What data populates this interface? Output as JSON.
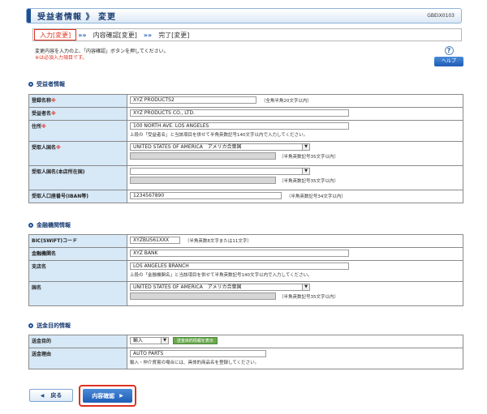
{
  "header": {
    "title": "受益者情報 》 変更",
    "screen_id": "GBEIX0103"
  },
  "steps": [
    {
      "label": "入力[変更]"
    },
    {
      "label": "内容確認[変更]"
    },
    {
      "label": "完了[変更]"
    }
  ],
  "step_separator": "»»",
  "instructions": {
    "line1": "変更内容を入力の上、「内容確認」ボタンを押してください。",
    "line2": "※は必須入力項目です。"
  },
  "help": {
    "icon": "?",
    "label": "ヘルプ"
  },
  "beneficiary": {
    "section_title": "受益者情報",
    "reg_name": {
      "label": "登録名称",
      "req": "※",
      "value": "XYZ PRODUCTS2",
      "note": "（全角半角20文字以内）"
    },
    "ben_name": {
      "label": "受益者名",
      "req": "※",
      "value": "XYZ PRODUCTS CO., LTD."
    },
    "address": {
      "label": "住所",
      "req": "※",
      "value": "100 NORTH AVE. LOS ANGELES",
      "note": "上段の「受益者名」と当該項目を併せて半角英数記号140文字以内で入力してください。"
    },
    "country": {
      "label": "受取人国名",
      "req": "※",
      "value": "UNITED STATES OF AMERICA　アメリカ合衆国",
      "note": "（半角英数記号35文字以内）"
    },
    "branch_country": {
      "label": "受取人国名(本店所在国)",
      "value": "",
      "note": "（半角英数記号35文字以内）"
    },
    "account": {
      "label": "受取人口座番号(IBAN等)",
      "value": "1234567890",
      "note": "（半角英数記号34文字以内）"
    }
  },
  "bank": {
    "section_title": "金融機関情報",
    "bic": {
      "label": "BIC(SWIFT)コード",
      "value": "XYZBUS61XXX",
      "note": "（半角英数8文字または11文字）"
    },
    "bank_name": {
      "label": "金融機関名",
      "value": "XYZ BANK"
    },
    "branch_name": {
      "label": "支店名",
      "value": "LOS ANGELES BRANCH",
      "note": "上段の「金融機関名」と当該項目を併せて半角英数記号140文字以内で入力してください。"
    },
    "country": {
      "label": "国名",
      "value": "UNITED STATES OF AMERICA　アメリカ合衆国",
      "note": "（半角英数記号35文字以内）"
    }
  },
  "purpose": {
    "section_title": "送金目的情報",
    "purpose": {
      "label": "送金目的",
      "value": "輸入",
      "button": "送金目的情報を表示"
    },
    "reason": {
      "label": "送金理由",
      "value": "AUTO PARTS",
      "note": "輸入・仲介貿易の場合には、具体的商品名を登録してください。"
    }
  },
  "buttons": {
    "back": "戻る",
    "confirm": "内容確認"
  }
}
